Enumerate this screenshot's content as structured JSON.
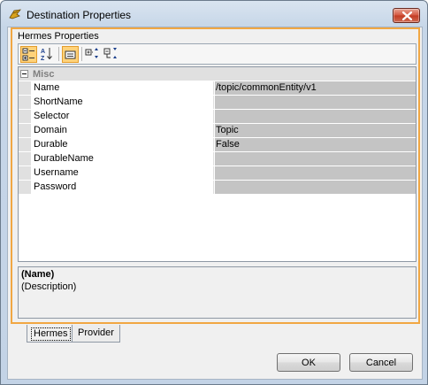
{
  "window": {
    "title": "Destination Properties"
  },
  "panel": {
    "title": "Hermes Properties"
  },
  "toolbar": {
    "items": [
      {
        "name": "categorized-view-icon",
        "active": true
      },
      {
        "name": "sort-alphabetical-icon",
        "active": false
      },
      {
        "name": "property-pages-icon",
        "active": true
      },
      {
        "name": "expand-all-icon",
        "active": false
      },
      {
        "name": "collapse-all-icon",
        "active": false
      }
    ]
  },
  "grid": {
    "category": "Misc",
    "rows": [
      {
        "name": "Name",
        "value": "/topic/commonEntity/v1"
      },
      {
        "name": "ShortName",
        "value": ""
      },
      {
        "name": "Selector",
        "value": ""
      },
      {
        "name": "Domain",
        "value": "Topic"
      },
      {
        "name": "Durable",
        "value": "False"
      },
      {
        "name": "DurableName",
        "value": ""
      },
      {
        "name": "Username",
        "value": ""
      },
      {
        "name": "Password",
        "value": ""
      }
    ]
  },
  "description": {
    "name": "(Name)",
    "text": "(Description)"
  },
  "tabs": [
    {
      "label": "Hermes",
      "selected": true
    },
    {
      "label": "Provider",
      "selected": false
    }
  ],
  "buttons": {
    "ok": "OK",
    "cancel": "Cancel"
  },
  "colors": {
    "accent_border": "#f1a743",
    "value_cell": "#c4c4c4",
    "category_band": "#e0e0e0"
  }
}
